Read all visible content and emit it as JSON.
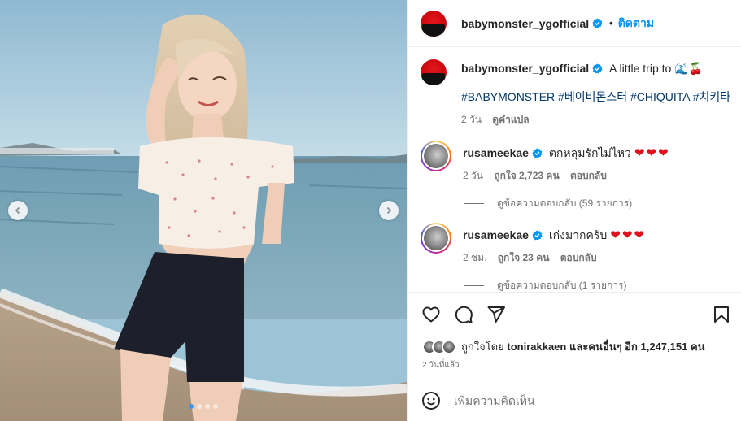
{
  "post": {
    "username": "babymonster_ygofficial",
    "follow_label": "ติดตาม",
    "separator": "•"
  },
  "caption": {
    "username": "babymonster_ygofficial",
    "text": "A little trip to",
    "emojis": "🌊🍒",
    "hashtags": "#BABYMONSTER #베이비몬스터 #CHIQUITA #치키타",
    "time": "2 วัน",
    "translate_label": "ดูคำแปล"
  },
  "comments": [
    {
      "username": "rusameekae",
      "text": "ตกหลุมรักไม่ไหว",
      "hearts": "❤❤❤",
      "time": "2 วัน",
      "likes": "ถูกใจ 2,723 คน",
      "reply_label": "ตอบกลับ",
      "view_replies": "ดูข้อความตอบกลับ (59 รายการ)"
    },
    {
      "username": "rusameekae",
      "text": "เก่งมากครับ",
      "hearts": "❤❤❤",
      "time": "2 ชม.",
      "likes": "ถูกใจ 23 คน",
      "reply_label": "ตอบกลับ",
      "view_replies": "ดูข้อความตอบกลับ (1 รายการ)"
    }
  ],
  "likes": {
    "prefix": "ถูกใจโดย",
    "user": "tonirakkaen",
    "middle": "และคนอื่นๆ อีก",
    "count": "1,247,151",
    "suffix": "คน"
  },
  "time_ago": "2 วันที่แล้ว",
  "add_comment": {
    "placeholder": "เพิ่มความคิดเห็น"
  },
  "carousel": {
    "total_slides": 4,
    "active_slide": 1
  },
  "colors": {
    "accent": "#0095f6",
    "verified": "#0095f6",
    "heart": "#e0101e",
    "hashtag": "#00376b"
  }
}
